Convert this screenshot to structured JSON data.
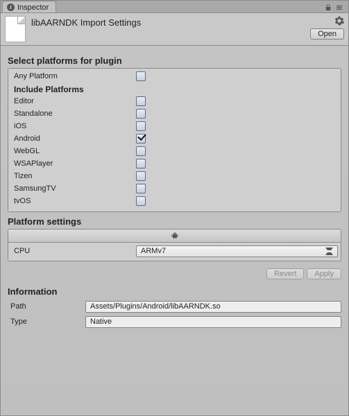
{
  "tab": {
    "title": "Inspector"
  },
  "header": {
    "title": "libAARNDK Import Settings",
    "open_label": "Open"
  },
  "platforms": {
    "section_title": "Select platforms for plugin",
    "any_label": "Any Platform",
    "any_checked": false,
    "include_title": "Include Platforms",
    "items": [
      {
        "label": "Editor",
        "checked": false
      },
      {
        "label": "Standalone",
        "checked": false
      },
      {
        "label": "iOS",
        "checked": false
      },
      {
        "label": "Android",
        "checked": true
      },
      {
        "label": "WebGL",
        "checked": false
      },
      {
        "label": "WSAPlayer",
        "checked": false
      },
      {
        "label": "Tizen",
        "checked": false
      },
      {
        "label": "SamsungTV",
        "checked": false
      },
      {
        "label": "tvOS",
        "checked": false
      }
    ]
  },
  "platform_settings": {
    "section_title": "Platform settings",
    "cpu_label": "CPU",
    "cpu_value": "ARMv7"
  },
  "actions": {
    "revert_label": "Revert",
    "apply_label": "Apply"
  },
  "info": {
    "section_title": "Information",
    "path_label": "Path",
    "path_value": "Assets/Plugins/Android/libAARNDK.so",
    "type_label": "Type",
    "type_value": "Native"
  }
}
